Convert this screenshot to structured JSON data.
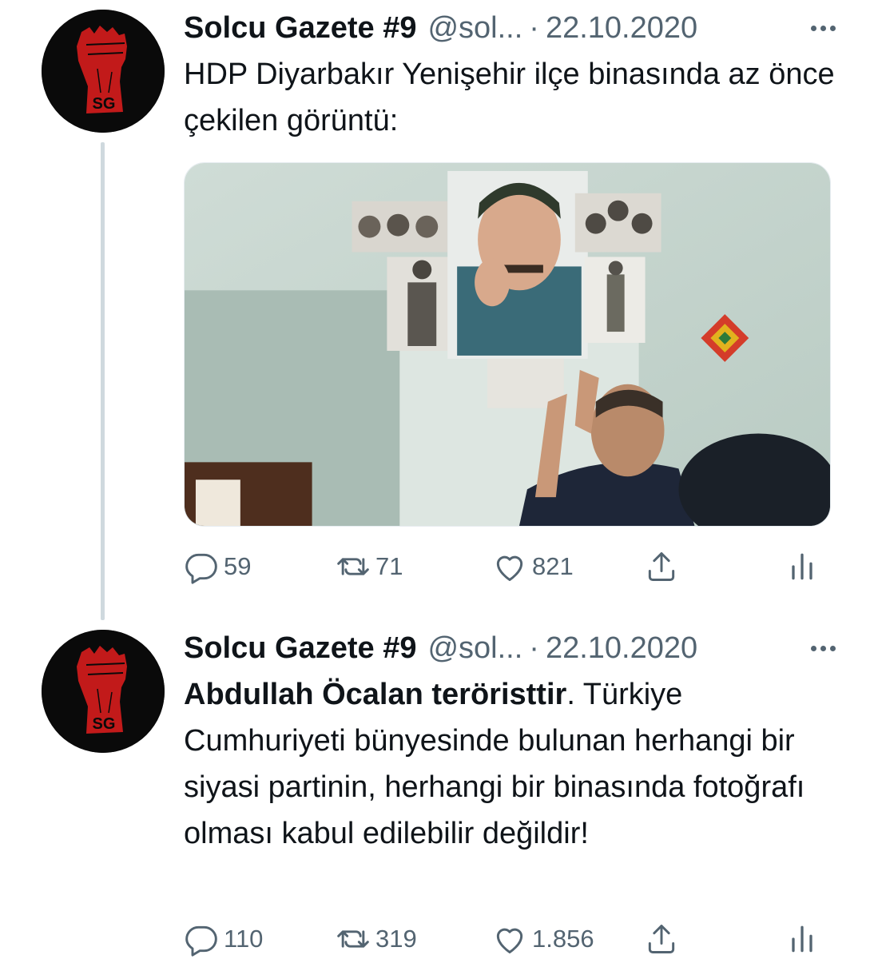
{
  "tweets": [
    {
      "author": {
        "name": "Solcu Gazete #9",
        "handle": "@sol...",
        "avatar_text": "SG"
      },
      "separator": "·",
      "date": "22.10.2020",
      "text": "HDP Diyarbakır Yenişehir ilçe binasında az önce çekilen görüntü:",
      "media": {
        "type": "photo"
      },
      "stats": {
        "replies": "59",
        "retweets": "71",
        "likes": "821"
      }
    },
    {
      "author": {
        "name": "Solcu Gazete #9",
        "handle": "@sol...",
        "avatar_text": "SG"
      },
      "separator": "·",
      "date": "22.10.2020",
      "text_bold": "Abdullah Öcalan teröristtir",
      "text_rest": ". Türkiye Cumhuriyeti bünyesinde bulunan herhangi bir siyasi partinin, herhangi bir binasında fotoğrafı olması kabul edilebilir değildir!",
      "stats": {
        "replies": "110",
        "retweets": "319",
        "likes": "1.856"
      }
    }
  ],
  "colors": {
    "text_primary": "#0f1419",
    "text_secondary": "#536471",
    "thread_line": "#cfd9de",
    "avatar_bg": "#0a0a0a",
    "avatar_fist": "#c21a1a"
  },
  "icons": [
    "more-icon",
    "reply-icon",
    "retweet-icon",
    "like-icon",
    "share-icon",
    "stats-icon"
  ]
}
